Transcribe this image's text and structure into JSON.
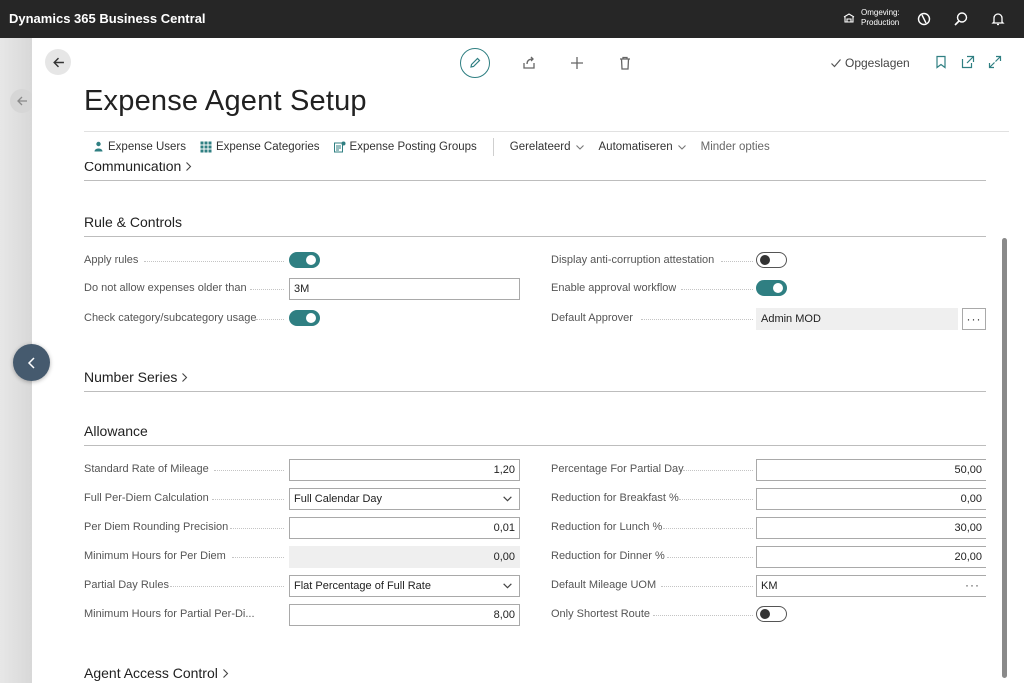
{
  "app": {
    "title": "Dynamics 365 Business Central"
  },
  "environment": {
    "label": "Omgeving:",
    "value": "Production"
  },
  "toolbar": {
    "saved_label": "Opgeslagen"
  },
  "page": {
    "title": "Expense Agent Setup"
  },
  "menu": {
    "items": [
      {
        "label": "Expense Users",
        "icon": "person-icon"
      },
      {
        "label": "Expense Categories",
        "icon": "grid-icon"
      },
      {
        "label": "Expense Posting Groups",
        "icon": "posting-groups-icon"
      }
    ],
    "related": "Gerelateerd",
    "automate": "Automatiseren",
    "fewer": "Minder opties"
  },
  "sections": {
    "communication": "Communication",
    "rules": "Rule & Controls",
    "number_series": "Number Series",
    "allowance": "Allowance",
    "agent_access": "Agent Access Control"
  },
  "rules": {
    "apply_rules": {
      "label": "Apply rules",
      "on": true
    },
    "older_than": {
      "label": "Do not allow expenses older than",
      "value": "3M"
    },
    "check_category": {
      "label": "Check category/subcategory usage",
      "on": true
    },
    "anti_corruption": {
      "label": "Display anti-corruption attestation",
      "on": false
    },
    "approval_workflow": {
      "label": "Enable approval workflow",
      "on": true
    },
    "default_approver": {
      "label": "Default Approver",
      "value": "Admin MOD",
      "assist": "···"
    }
  },
  "allowance": {
    "standard_rate": {
      "label": "Standard Rate of Mileage",
      "value": "1,20"
    },
    "full_per_diem": {
      "label": "Full Per-Diem Calculation",
      "value": "Full Calendar Day"
    },
    "rounding": {
      "label": "Per Diem Rounding Precision",
      "value": "0,01"
    },
    "min_hours": {
      "label": "Minimum Hours for Per Diem",
      "value": "0,00"
    },
    "partial_rules": {
      "label": "Partial Day Rules",
      "value": "Flat Percentage of Full Rate"
    },
    "min_partial": {
      "label": "Minimum Hours for Partial Per-Di...",
      "value": "8,00"
    },
    "pct_partial": {
      "label": "Percentage For Partial Day",
      "value": "50,00"
    },
    "breakfast": {
      "label": "Reduction for Breakfast %",
      "value": "0,00"
    },
    "lunch": {
      "label": "Reduction for Lunch %",
      "value": "30,00"
    },
    "dinner": {
      "label": "Reduction for Dinner %",
      "value": "20,00"
    },
    "mileage_uom": {
      "label": "Default Mileage UOM",
      "value": "KM",
      "assist": "···"
    },
    "shortest_route": {
      "label": "Only Shortest Route",
      "on": false
    }
  },
  "colors": {
    "accent": "#2f7f82",
    "topbar": "#262626",
    "float_nav": "#455a6e"
  }
}
